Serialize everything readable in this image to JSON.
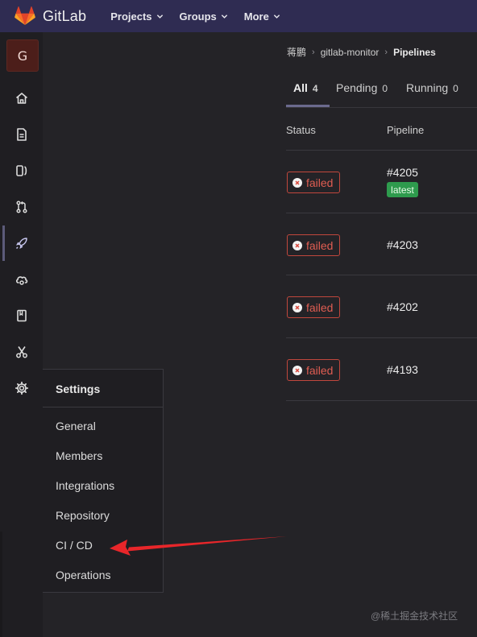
{
  "header": {
    "brand": "GitLab",
    "nav": [
      "Projects",
      "Groups",
      "More"
    ],
    "brand_color": "#fc6d26",
    "bar_color": "#2f2c52"
  },
  "sidebar": {
    "avatar_letter": "G",
    "icons": [
      "home-icon",
      "file-icon",
      "issues-icon",
      "merge-request-icon",
      "rocket-icon",
      "cloud-icon",
      "wiki-icon",
      "scissors-icon",
      "gear-icon"
    ]
  },
  "flyout": {
    "title": "Settings",
    "items": [
      "General",
      "Members",
      "Integrations",
      "Repository",
      "CI / CD",
      "Operations"
    ]
  },
  "breadcrumb": [
    "蒋鹏",
    "gitlab-monitor",
    "Pipelines"
  ],
  "tabs": [
    {
      "label": "All",
      "count": "4"
    },
    {
      "label": "Pending",
      "count": "0"
    },
    {
      "label": "Running",
      "count": "0"
    }
  ],
  "table": {
    "columns": [
      "Status",
      "Pipeline"
    ],
    "rows": [
      {
        "status": "failed",
        "pipeline": "#4205",
        "badge": "latest"
      },
      {
        "status": "failed",
        "pipeline": "#4203"
      },
      {
        "status": "failed",
        "pipeline": "#4202"
      },
      {
        "status": "failed",
        "pipeline": "#4193"
      }
    ]
  },
  "colors": {
    "failed": "#e05d52",
    "latest": "#2e9b4d",
    "arrow": "#e8262a"
  },
  "watermark": "@稀土掘金技术社区"
}
